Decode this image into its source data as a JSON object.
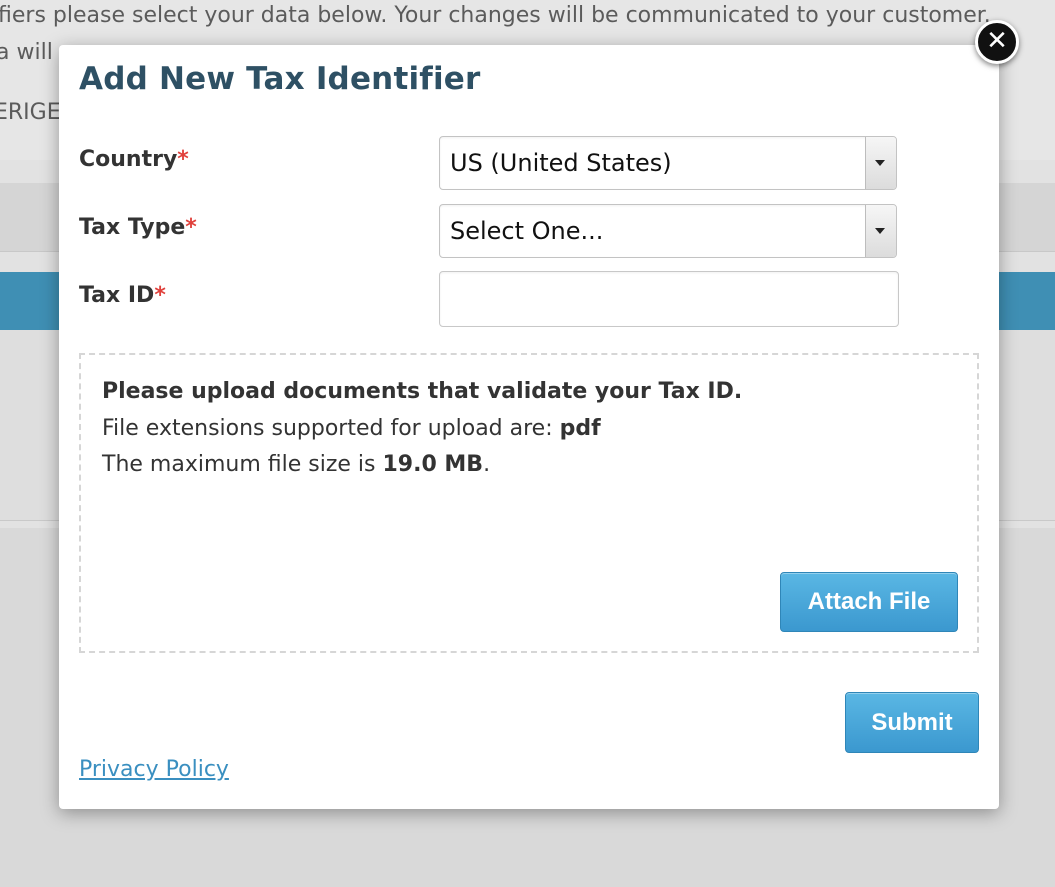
{
  "background": {
    "line1": "fiers please select your data below. Your changes will be communicated to your customer.",
    "line2": "a will",
    "line3": "ERIGE"
  },
  "modal": {
    "title": "Add New Tax Identifier",
    "close_icon": "close-icon",
    "required_marker": "*",
    "fields": {
      "country": {
        "label": "Country",
        "value": "US (United States)"
      },
      "tax_type": {
        "label": "Tax Type",
        "value": "Select One..."
      },
      "tax_id": {
        "label": "Tax ID",
        "value": "",
        "placeholder": ""
      }
    },
    "upload": {
      "heading": "Please upload documents that validate your Tax ID.",
      "extensions_prefix": "File extensions supported for upload are: ",
      "extensions_value": "pdf",
      "size_prefix": "The maximum file size is ",
      "size_value": "19.0 MB",
      "size_suffix": ".",
      "attach_label": "Attach File"
    },
    "submit_label": "Submit",
    "privacy_label": "Privacy Policy"
  },
  "colors": {
    "title": "#2e5064",
    "required": "#e0413c",
    "button": "#3b98cf",
    "link": "#3a8fc0",
    "background_band": "#3f8fb4"
  }
}
